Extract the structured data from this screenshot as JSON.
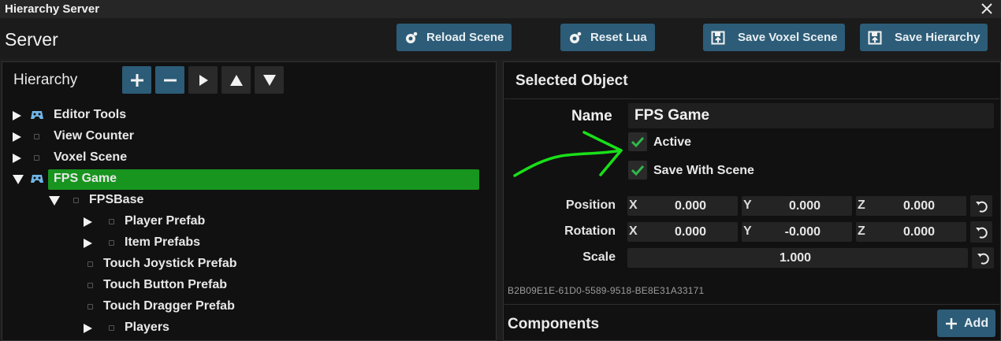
{
  "window": {
    "title": "Hierarchy Server"
  },
  "toolbar": {
    "title": "Server",
    "buttons": [
      {
        "label": "Reload Scene",
        "icon": "reload-icon"
      },
      {
        "label": "Reset Lua",
        "icon": "reset-icon"
      },
      {
        "label": "Save Voxel Scene",
        "icon": "save-icon"
      },
      {
        "label": "Save Hierarchy",
        "icon": "save-icon"
      }
    ]
  },
  "hierarchy": {
    "title": "Hierarchy",
    "buttons": [
      "add-icon",
      "remove-icon",
      "play-icon",
      "move-up-icon",
      "move-down-icon"
    ],
    "items": [
      {
        "label": "Editor Tools",
        "depth": 0,
        "expanded": false,
        "has_arrow": true,
        "icon": "controller-icon",
        "selected": false
      },
      {
        "label": "View Counter",
        "depth": 0,
        "expanded": false,
        "has_arrow": true,
        "icon": "square",
        "selected": false
      },
      {
        "label": "Voxel Scene",
        "depth": 0,
        "expanded": false,
        "has_arrow": true,
        "icon": "square",
        "selected": false
      },
      {
        "label": "FPS Game",
        "depth": 0,
        "expanded": true,
        "has_arrow": true,
        "icon": "controller-icon",
        "selected": true
      },
      {
        "label": "FPSBase",
        "depth": 1,
        "expanded": true,
        "has_arrow": true,
        "icon": "square",
        "selected": false
      },
      {
        "label": "Player Prefab",
        "depth": 2,
        "expanded": false,
        "has_arrow": true,
        "icon": "square",
        "selected": false
      },
      {
        "label": "Item Prefabs",
        "depth": 2,
        "expanded": false,
        "has_arrow": true,
        "icon": "square",
        "selected": false
      },
      {
        "label": "Touch Joystick Prefab",
        "depth": 2,
        "expanded": false,
        "has_arrow": false,
        "icon": "square",
        "selected": false
      },
      {
        "label": "Touch Button Prefab",
        "depth": 2,
        "expanded": false,
        "has_arrow": false,
        "icon": "square",
        "selected": false
      },
      {
        "label": "Touch Dragger Prefab",
        "depth": 2,
        "expanded": false,
        "has_arrow": false,
        "icon": "square",
        "selected": false
      },
      {
        "label": "Players",
        "depth": 2,
        "expanded": false,
        "has_arrow": true,
        "icon": "square",
        "selected": false
      }
    ]
  },
  "selected_object": {
    "title": "Selected Object",
    "name_label": "Name",
    "name_value": "FPS Game",
    "active_label": "Active",
    "active_checked": true,
    "save_label": "Save With Scene",
    "save_checked": true,
    "position": {
      "label": "Position",
      "x_axis": "X",
      "x": "0.000",
      "y_axis": "Y",
      "y": "0.000",
      "z_axis": "Z",
      "z": "0.000"
    },
    "rotation": {
      "label": "Rotation",
      "x_axis": "X",
      "x": "0.000",
      "y_axis": "Y",
      "y": "-0.000",
      "z_axis": "Z",
      "z": "0.000"
    },
    "scale": {
      "label": "Scale",
      "value": "1.000"
    },
    "guid": "B2B09E1E-61D0-5589-9518-BE8E31A33171",
    "components_title": "Components",
    "add_label": "Add"
  },
  "colors": {
    "accent_button": "#2c5c77",
    "selection": "#18951f",
    "annotation": "#19e019",
    "checkmark": "#2fb84a"
  }
}
